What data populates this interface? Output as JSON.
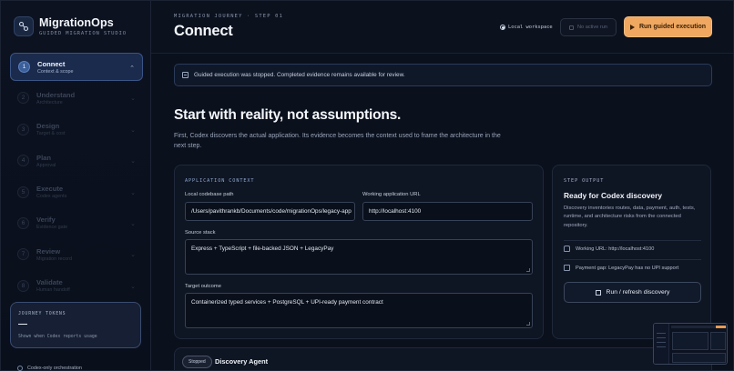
{
  "brand": {
    "name": "MigrationOps",
    "subtitle": "GUIDED MIGRATION STUDIO"
  },
  "steps": [
    {
      "num": "1",
      "title": "Connect",
      "subtitle": "Context & scope",
      "active": true
    },
    {
      "num": "2",
      "title": "Understand",
      "subtitle": "Architecture",
      "active": false
    },
    {
      "num": "3",
      "title": "Design",
      "subtitle": "Target & cost",
      "active": false
    },
    {
      "num": "4",
      "title": "Plan",
      "subtitle": "Approval",
      "active": false
    },
    {
      "num": "5",
      "title": "Execute",
      "subtitle": "Codex agents",
      "active": false
    },
    {
      "num": "6",
      "title": "Verify",
      "subtitle": "Evidence gate",
      "active": false
    },
    {
      "num": "7",
      "title": "Review",
      "subtitle": "Migration record",
      "active": false
    },
    {
      "num": "8",
      "title": "Validate",
      "subtitle": "Human handoff",
      "active": false
    }
  ],
  "tokens": {
    "title": "JOURNEY TOKENS",
    "value": "—",
    "note": "Shown when Codex reports usage"
  },
  "sidebar_footer": {
    "label": "Codex-only orchestration"
  },
  "header": {
    "eyebrow": "MIGRATION JOURNEY · STEP 01",
    "title": "Connect",
    "workspace_label": "Local workspace",
    "no_active_run": "No active run",
    "run_button": "Run guided execution"
  },
  "notice": {
    "text": "Guided execution was stopped. Completed evidence remains available for review."
  },
  "hero": {
    "title": "Start with reality, not assumptions.",
    "description": "First, Codex discovers the actual application. Its evidence becomes the context used to frame the architecture in the next step."
  },
  "context": {
    "section_label": "APPLICATION CONTEXT",
    "codebase_label": "Local codebase path",
    "codebase_value": "/Users/pavithrankb/Documents/code/migrationOps/legacy-app",
    "url_label": "Working application URL",
    "url_value": "http://localhost:4100",
    "stack_label": "Source stack",
    "stack_value": "Express + TypeScript + file-backed JSON + LegacyPay",
    "target_label": "Target outcome",
    "target_value": "Containerized typed services + PostgreSQL + UPI-ready payment contract"
  },
  "output": {
    "section_label": "STEP OUTPUT",
    "title": "Ready for Codex discovery",
    "description": "Discovery inventories routes, data, payment, auth, tests, runtime, and architecture risks from the connected repository.",
    "url_row": "Working URL: http://localhost:4100",
    "gap_row": "Payment gap: LegacyPay has no UPI support",
    "refresh_button": "Run / refresh discovery"
  },
  "agent": {
    "status": "Stopped",
    "name": "Discovery Agent"
  },
  "colors": {
    "accent": "#f0a760",
    "active_step": "#1b2b4d",
    "background": "#0a101c"
  }
}
